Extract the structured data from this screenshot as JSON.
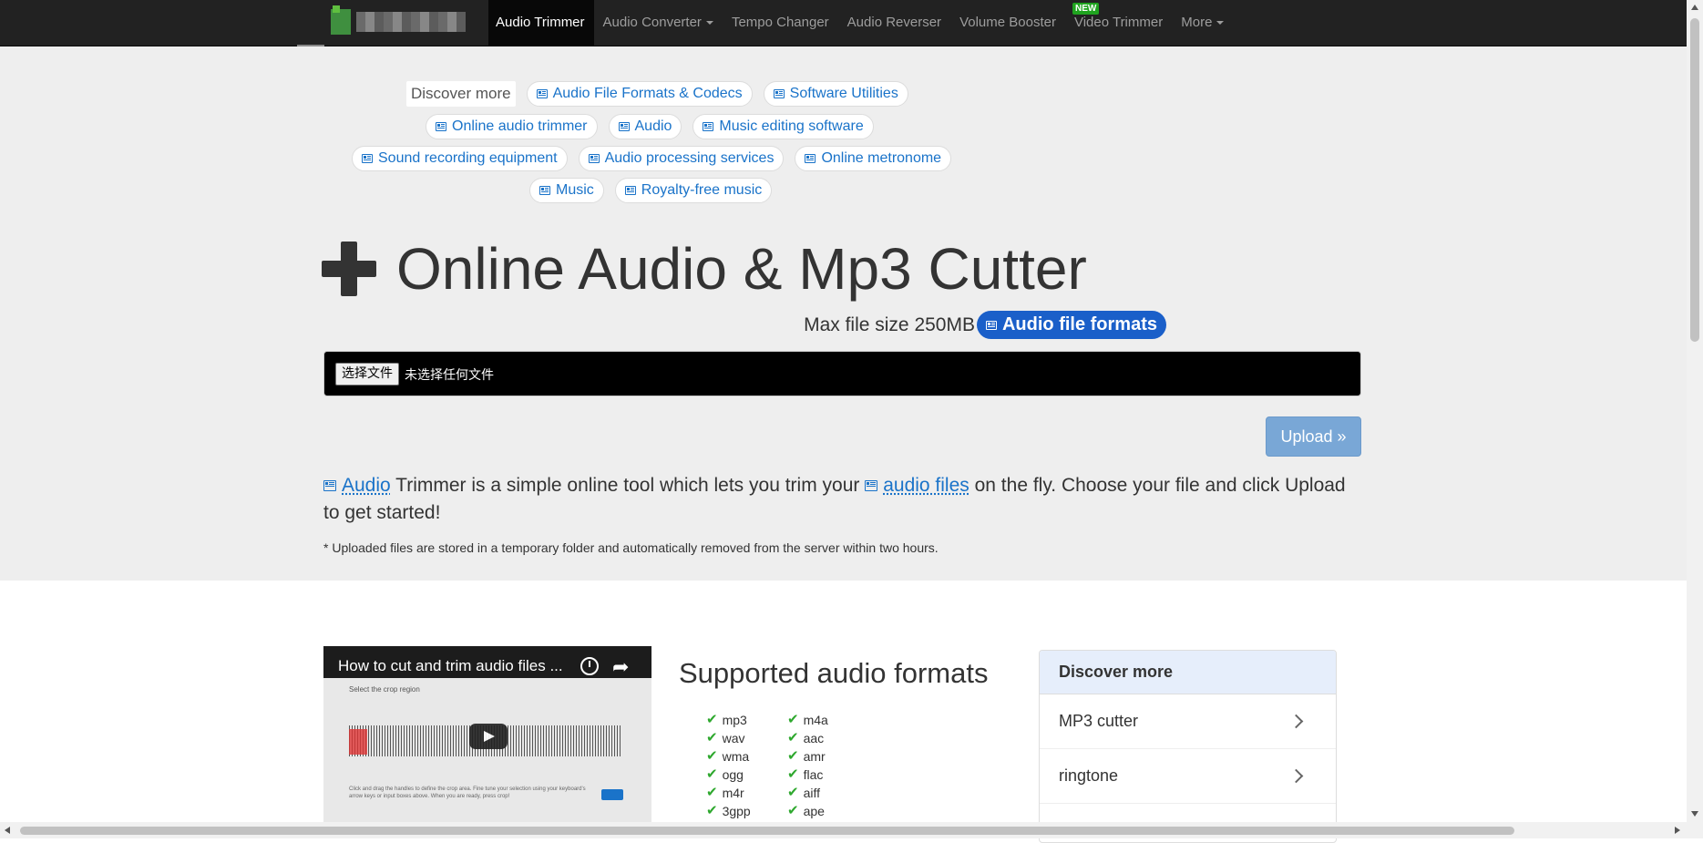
{
  "nav": {
    "items": [
      {
        "label": "Audio Trimmer",
        "active": true
      },
      {
        "label": "Audio Converter",
        "dropdown": true
      },
      {
        "label": "Tempo Changer"
      },
      {
        "label": "Audio Reverser"
      },
      {
        "label": "Volume Booster"
      },
      {
        "label": "Video Trimmer",
        "badge": "NEW"
      },
      {
        "label": "More",
        "dropdown": true
      }
    ]
  },
  "discover": {
    "label": "Discover more",
    "chips": [
      "Audio File Formats & Codecs",
      "Software Utilities",
      "Online audio trimmer",
      "Audio",
      "Music editing software",
      "Sound recording equipment",
      "Audio processing services",
      "Online metronome",
      "Music",
      "Royalty-free music"
    ]
  },
  "hero": {
    "title": "Online Audio & Mp3 Cutter",
    "max_size": "Max file size 250MB",
    "formats_link": "Audio file formats",
    "choose_file": "选择文件",
    "no_file": "未选择任何文件",
    "upload": "Upload »",
    "desc_link1": "Audio",
    "desc_part1": " Trimmer is a simple online tool which lets you trim your ",
    "desc_link2": "audio files",
    "desc_part2": " on the fly. Choose your file and click Upload to get started!",
    "note": "* Uploaded files are stored in a temporary folder and automatically removed from the server within two hours."
  },
  "video": {
    "title": "How to cut and trim audio files ...",
    "caption": "Select the crop region",
    "text": "Click and drag the handles to define the crop area. Fine tune your selection using your keyboard's arrow keys or input boxes above. When you are ready, press crop!",
    "crop": "Crop »"
  },
  "formats": {
    "heading": "Supported audio formats",
    "col1": [
      "mp3",
      "wav",
      "wma",
      "ogg",
      "m4r",
      "3gpp"
    ],
    "col2": [
      "m4a",
      "aac",
      "amr",
      "flac",
      "aiff",
      "ape"
    ]
  },
  "discover_panel": {
    "heading": "Discover more",
    "items": [
      "MP3 cutter",
      "ringtone"
    ]
  },
  "icons": {
    "chip": "newspaper-icon",
    "check": "checkmark-icon",
    "plus": "plus-icon"
  },
  "colors": {
    "navbar": "#222222",
    "link": "#1a73c9",
    "pill": "#1a5fc9",
    "check": "#2ea82e",
    "upload": "#79a7d6"
  }
}
